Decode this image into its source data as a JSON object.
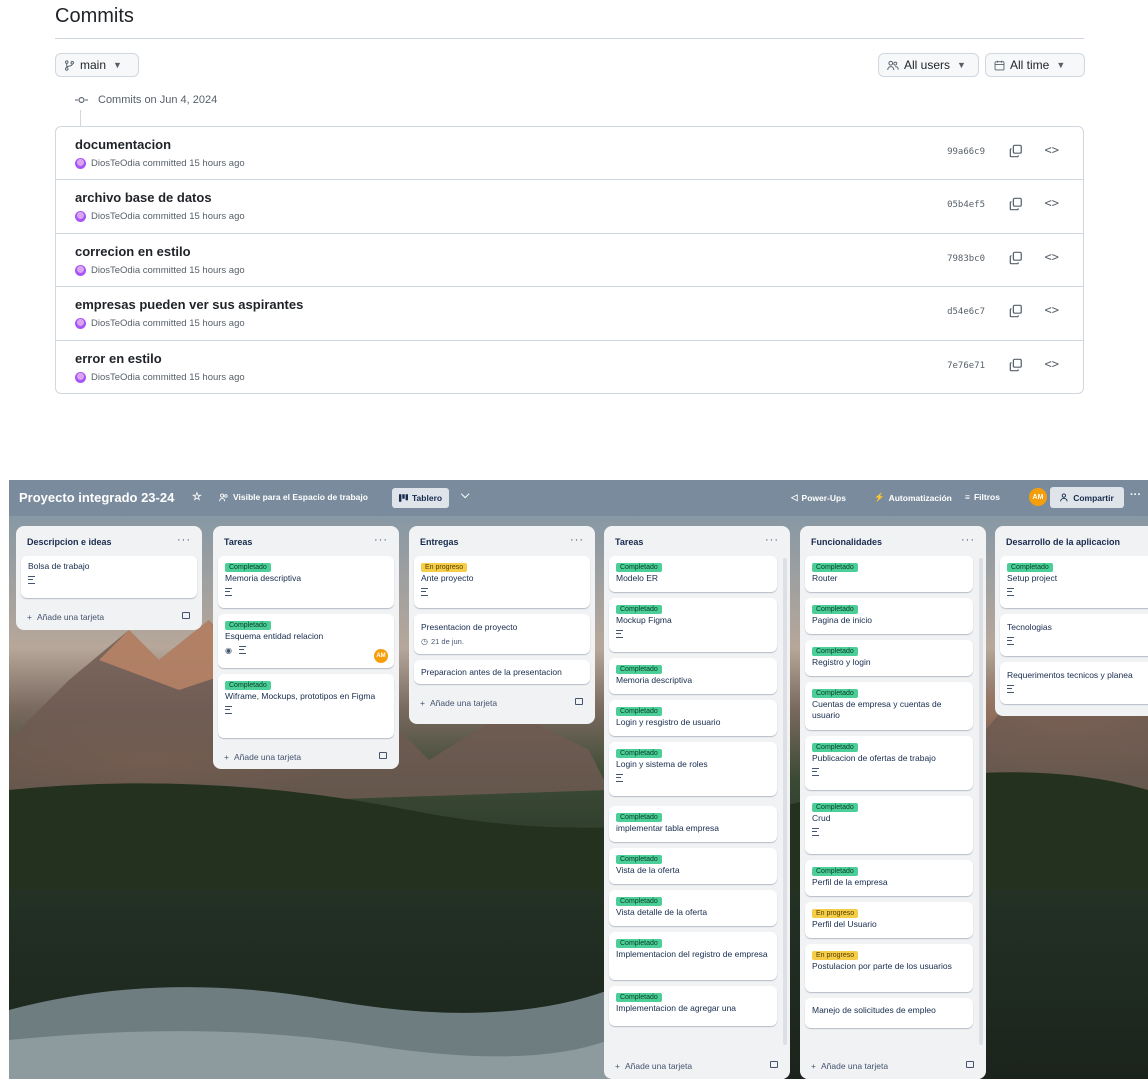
{
  "github": {
    "title": "Commits",
    "branch": "main",
    "users_filter": "All users",
    "time_filter": "All time",
    "date_group": "Commits on Jun 4, 2024",
    "commits": [
      {
        "message": "documentacion",
        "meta": "DiosTeOdia committed 15 hours ago",
        "sha": "99a66c9"
      },
      {
        "message": "archivo base de datos",
        "meta": "DiosTeOdia committed 15 hours ago",
        "sha": "05b4ef5"
      },
      {
        "message": "correcion en estilo",
        "meta": "DiosTeOdia committed 15 hours ago",
        "sha": "7983bc0"
      },
      {
        "message": "empresas pueden ver sus aspirantes",
        "meta": "DiosTeOdia committed 15 hours ago",
        "sha": "d54e6c7"
      },
      {
        "message": "error en estilo",
        "meta": "DiosTeOdia committed 15 hours ago",
        "sha": "7e76e71"
      }
    ]
  },
  "trello": {
    "board_title": "Proyecto integrado 23-24",
    "visibility": "Visible para el Espacio de trabajo",
    "view": "Tablero",
    "power_ups": "Power-Ups",
    "automation": "Automatización",
    "filters": "Filtros",
    "member_initials": "AM",
    "share": "Compartir",
    "add_card": "Añade una tarjeta",
    "lists": [
      {
        "title": "Descripcion e ideas",
        "cards": [
          {
            "title": "Bolsa de trabajo"
          }
        ]
      },
      {
        "title": "Tareas",
        "cards": [
          {
            "label": "Completado",
            "title": "Memoria descriptiva"
          },
          {
            "label": "Completado",
            "title": "Esquema entidad relacion",
            "avatar": "AM"
          },
          {
            "label": "Completado",
            "title": "Wiframe, Mockups, prototipos en Figma"
          }
        ]
      },
      {
        "title": "Entregas",
        "cards": [
          {
            "label": "En progreso",
            "title": "Ante proyecto"
          },
          {
            "title": "Presentacion de proyecto",
            "due": "21 de jun."
          },
          {
            "title": "Preparacion antes de la presentacion"
          }
        ]
      },
      {
        "title": "Tareas",
        "cards": [
          {
            "label": "Completado",
            "title": "Modelo ER"
          },
          {
            "label": "Completado",
            "title": "Mockup Figma"
          },
          {
            "label": "Completado",
            "title": "Memoria descriptiva"
          },
          {
            "label": "Completado",
            "title": "Login y resgistro de usuario"
          },
          {
            "label": "Completado",
            "title": "Login y sistema de roles"
          },
          {
            "label": "Completado",
            "title": "implementar tabla empresa"
          },
          {
            "label": "Completado",
            "title": "Vista de la oferta"
          },
          {
            "label": "Completado",
            "title": "Vista detalle de la oferta"
          },
          {
            "label": "Completado",
            "title": "Implementacion del registro de empresa"
          },
          {
            "label": "Completado",
            "title": "Implementacion de agregar una"
          }
        ]
      },
      {
        "title": "Funcionalidades",
        "cards": [
          {
            "label": "Completado",
            "title": "Router"
          },
          {
            "label": "Completado",
            "title": "Pagina de inicio"
          },
          {
            "label": "Completado",
            "title": "Registro y login"
          },
          {
            "label": "Completado",
            "title": "Cuentas de empresa y cuentas de usuario"
          },
          {
            "label": "Completado",
            "title": "Publicacion de ofertas de trabajo"
          },
          {
            "label": "Completado",
            "title": "Crud"
          },
          {
            "label": "Completado",
            "title": "Perfil de la empresa"
          },
          {
            "label": "En progreso",
            "title": "Perfil del Usuario"
          },
          {
            "label": "En progreso",
            "title": "Postulacion por parte de los usuarios"
          },
          {
            "title": "Manejo de solicitudes de empleo"
          }
        ]
      },
      {
        "title": "Desarrollo de la aplicacion",
        "cards": [
          {
            "label": "Completado",
            "title": "Setup project"
          },
          {
            "title": "Tecnologias"
          },
          {
            "title": "Requerimentos tecnicos y planea"
          }
        ]
      }
    ]
  },
  "colors": {
    "label_completed": "#4bce97",
    "label_in_progress": "#f5cd47",
    "avatar": "#f59e0b",
    "commit_avatar": "#a855f7"
  },
  "icons": {
    "branch": "git-branch-icon",
    "users": "people-icon",
    "calendar": "calendar-icon",
    "commit": "git-commit-icon",
    "copy": "copy-icon",
    "browse": "code-brackets-icon",
    "star": "star-icon",
    "visibility": "people-icon",
    "board": "board-icon",
    "power_ups": "rocket-icon",
    "automation": "lightning-icon",
    "filters": "filter-icon",
    "share": "person-add-icon",
    "watch": "eye-icon",
    "description": "description-icon",
    "due": "clock-icon",
    "template": "card-template-icon"
  }
}
